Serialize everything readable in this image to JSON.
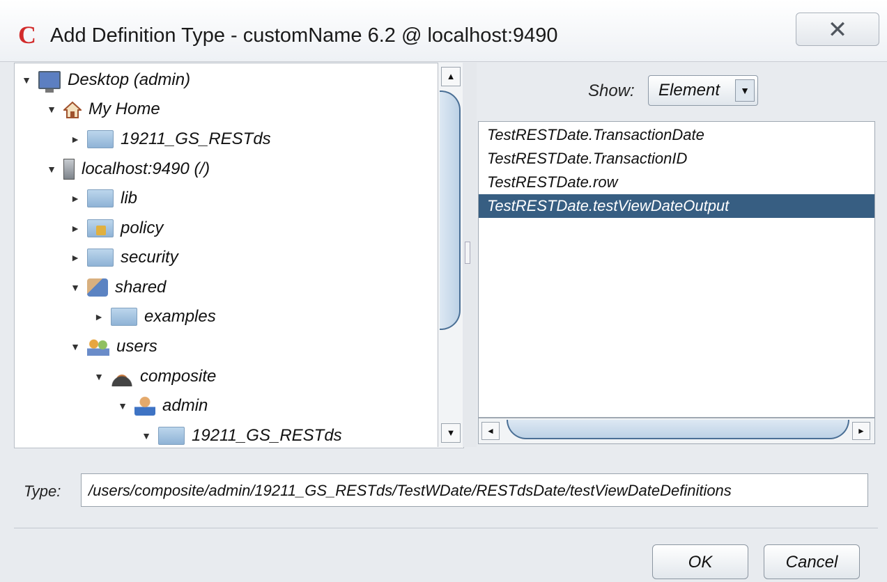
{
  "window": {
    "app_icon": "C",
    "title": "Add Definition Type - customName 6.2 @ localhost:9490",
    "close_glyph": "✕"
  },
  "tree": {
    "items": [
      {
        "label": "Desktop (admin)",
        "toggle": "▼",
        "icon": "desktop-icon",
        "level": 0
      },
      {
        "label": "My Home",
        "toggle": "▼",
        "icon": "home-icon",
        "level": 1
      },
      {
        "label": "19211_GS_RESTds",
        "toggle": "►",
        "icon": "folder-icon",
        "level": 2
      },
      {
        "label": "localhost:9490 (/)",
        "toggle": "▼",
        "icon": "server-icon",
        "level": 1
      },
      {
        "label": "lib",
        "toggle": "►",
        "icon": "folder-icon",
        "level": 2
      },
      {
        "label": "policy",
        "toggle": "►",
        "icon": "locked-folder-icon",
        "level": 2
      },
      {
        "label": "security",
        "toggle": "►",
        "icon": "folder-icon",
        "level": 2
      },
      {
        "label": "shared",
        "toggle": "▼",
        "icon": "shared-folder-icon",
        "level": 2
      },
      {
        "label": "examples",
        "toggle": "►",
        "icon": "folder-icon",
        "level": 3
      },
      {
        "label": "users",
        "toggle": "▼",
        "icon": "users-icon",
        "level": 2
      },
      {
        "label": "composite",
        "toggle": "▼",
        "icon": "composite-domain-icon",
        "level": 3
      },
      {
        "label": "admin",
        "toggle": "▼",
        "icon": "user-icon",
        "level": 4
      },
      {
        "label": "19211_GS_RESTds",
        "toggle": "▼",
        "icon": "folder-icon",
        "level": 5
      }
    ],
    "scroll_up_glyph": "▲",
    "scroll_down_glyph": "▼"
  },
  "filter": {
    "label": "Show:",
    "value": "Element",
    "arrow_glyph": "▼"
  },
  "list": {
    "items": [
      "TestRESTDate.TransactionDate",
      "TestRESTDate.TransactionID",
      "TestRESTDate.row",
      "TestRESTDate.testViewDateOutput"
    ],
    "selected_index": 3,
    "scroll_left_glyph": "◄",
    "scroll_right_glyph": "►"
  },
  "type_field": {
    "label": "Type:",
    "value": "/users/composite/admin/19211_GS_RESTds/TestWDate/RESTdsDate/testViewDateDefinitions"
  },
  "buttons": {
    "ok": "OK",
    "cancel": "Cancel"
  }
}
